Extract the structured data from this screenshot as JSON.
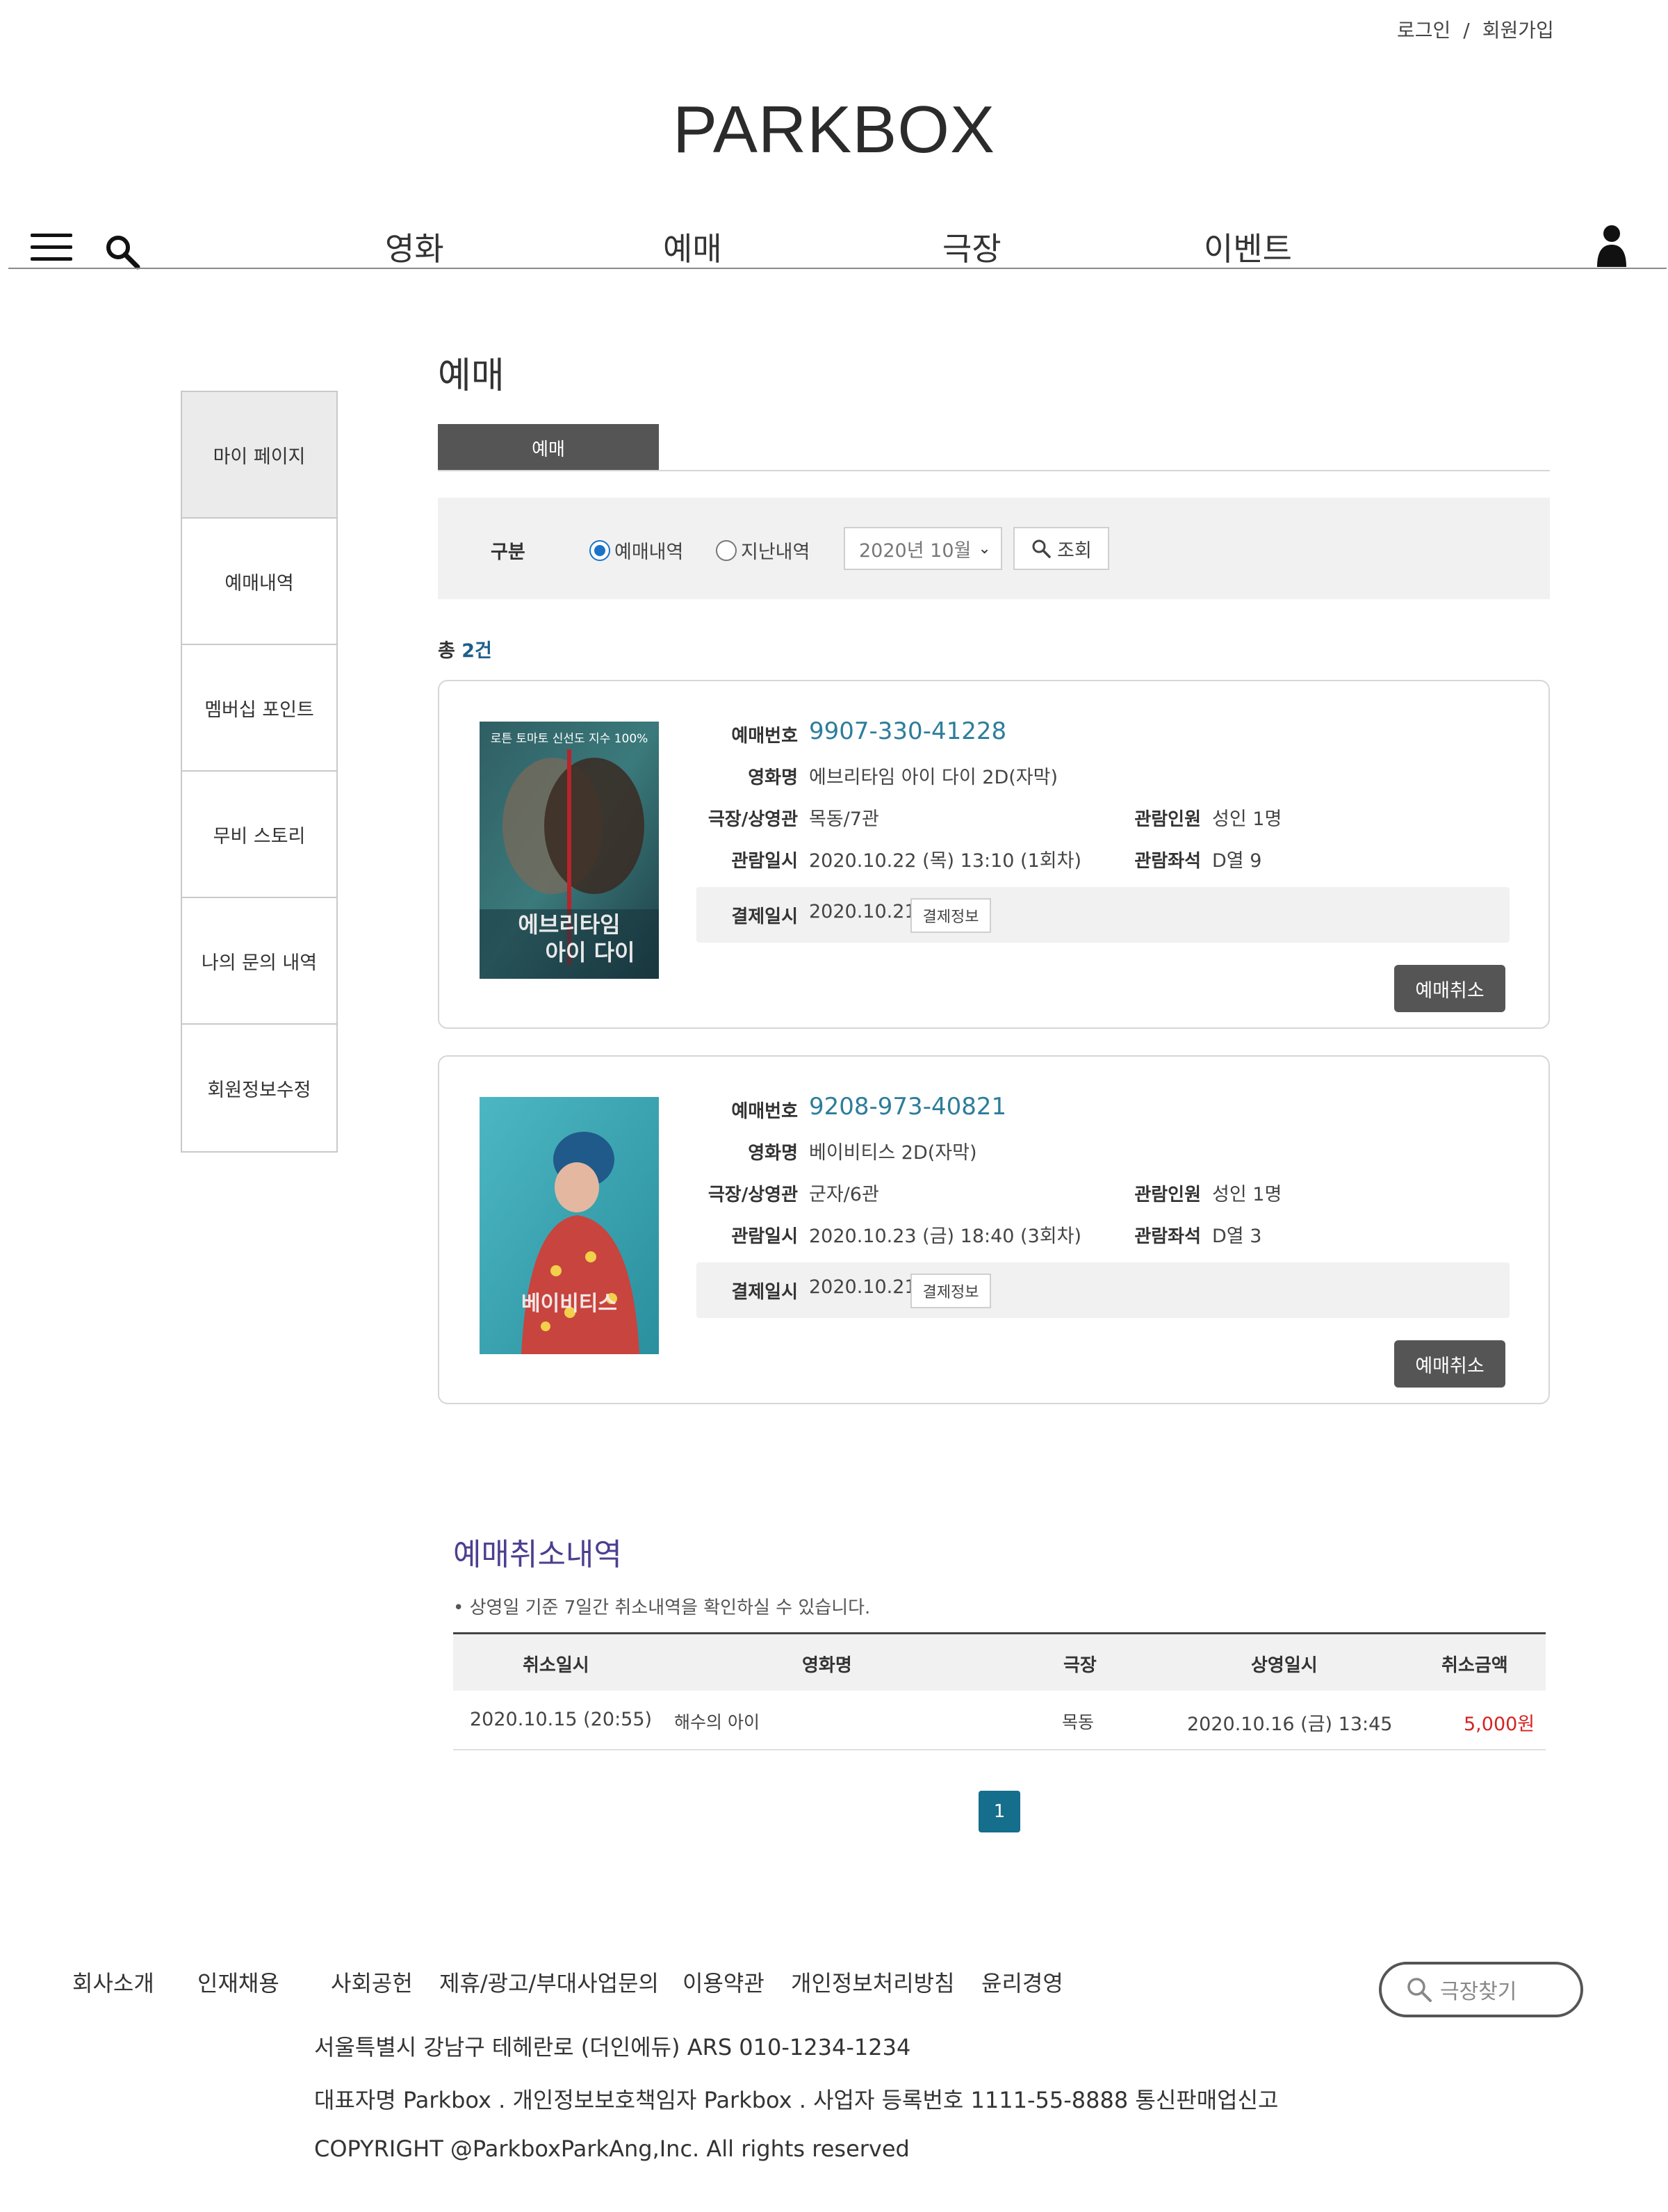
{
  "header": {
    "login": "로그인",
    "separator": "/",
    "signup": "회원가입",
    "logo": "PARKBOX"
  },
  "nav": {
    "items": [
      "영화",
      "예매",
      "극장",
      "이벤트"
    ],
    "icons": [
      "menu-icon",
      "search-icon",
      "user-icon"
    ]
  },
  "sidebar": {
    "items": [
      "마이 페이지",
      "예매내역",
      "멤버십 포인트",
      "무비 스토리",
      "나의 문의 내역",
      "회원정보수정"
    ],
    "active_index": 0
  },
  "main": {
    "title": "예매",
    "tab": "예매",
    "filter": {
      "label": "구분",
      "radio_current": "예매내역",
      "radio_past": "지난내역",
      "selected_radio": "예매내역",
      "month": "2020년 10월",
      "search_button": "조회"
    },
    "total_prefix": "총",
    "total_count": "2건"
  },
  "labels": {
    "booking_no": "예매번호",
    "movie": "영화명",
    "theater": "극장/상영관",
    "datetime": "관람일시",
    "people": "관람인원",
    "seat": "관람좌석",
    "paid": "결제일시",
    "pay_info": "결제정보",
    "cancel": "예매취소"
  },
  "bookings": [
    {
      "booking_no": "9907-330-41228",
      "movie": "에브리타임 아이 다이 2D(자막)",
      "theater": "목동/7관",
      "datetime": "2020.10.22 (목) 13:10 (1회차)",
      "people": "성인 1명",
      "seat": "D열 9",
      "paid": "2020.10.21",
      "poster_top_text": "로튼 토마토 신선도 지수 100%",
      "poster_title_1": "에브리타임",
      "poster_title_2": "아이 다이"
    },
    {
      "booking_no": "9208-973-40821",
      "movie": "베이비티스 2D(자막)",
      "theater": "군자/6관",
      "datetime": "2020.10.23 (금) 18:40 (3회차)",
      "people": "성인 1명",
      "seat": "D열 3",
      "paid": "2020.10.21",
      "poster_title_1": "베이비티스"
    }
  ],
  "cancel_history": {
    "title": "예매취소내역",
    "note": "• 상영일 기준 7일간 취소내역을 확인하실 수 있습니다.",
    "headers": [
      "취소일시",
      "영화명",
      "극장",
      "상영일시",
      "취소금액"
    ],
    "rows": [
      {
        "cancel_time": "2020.10.15 (20:55)",
        "movie": "해수의 아이",
        "theater": "목동",
        "show_time": "2020.10.16 (금) 13:45",
        "amount": "5,000원"
      }
    ],
    "page": "1"
  },
  "footer": {
    "links": [
      "회사소개",
      "인재채용",
      "사회공헌",
      "제휴/광고/부대사업문의",
      "이용약관",
      "개인정보처리방침",
      "윤리경영"
    ],
    "search_placeholder": "극장찾기",
    "address": "서울특별시 강남구 테헤란로 (더인에듀) ARS 010-1234-1234",
    "company": "대표자명 Parkbox . 개인정보보호책임자 Parkbox . 사업자 등록번호 1111-55-8888 통신판매업신고",
    "copyright": "COPYRIGHT @ParkboxParkAng,Inc. All rights reserved"
  },
  "colors": {
    "accent_blue": "#2d7d9a",
    "cancel_title": "#4b3f8f",
    "pager": "#156e8c",
    "amount_red": "#d62222",
    "dark_button": "#555555"
  }
}
